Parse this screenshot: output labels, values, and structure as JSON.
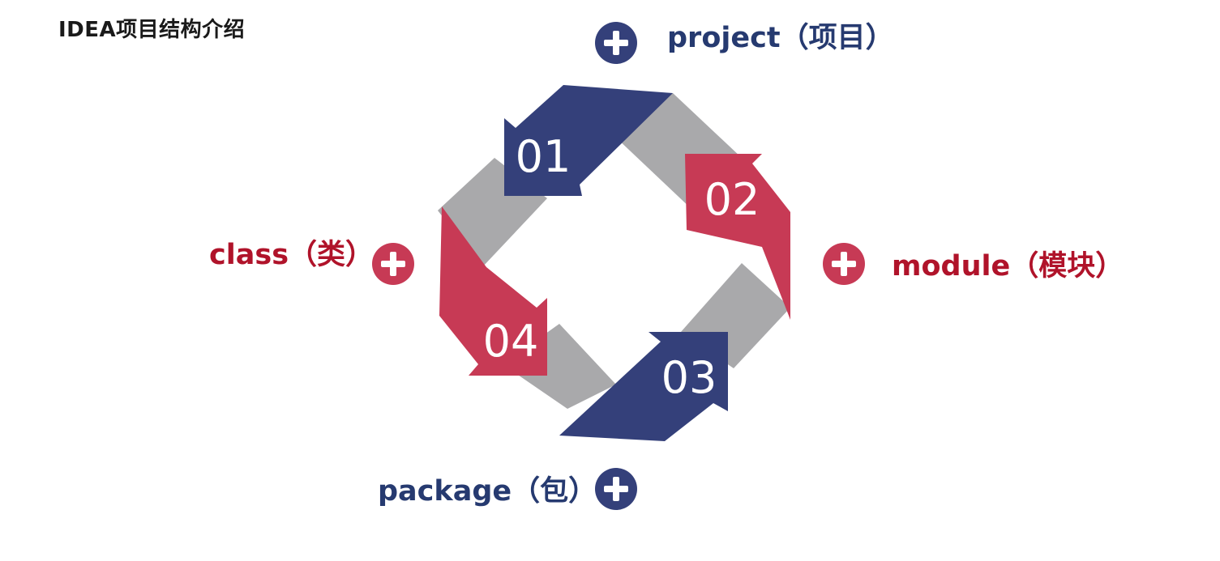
{
  "slide": {
    "title": "IDEA项目结构介绍"
  },
  "steps": [
    {
      "number": "01",
      "label": "project（项目）",
      "color": "#34407a"
    },
    {
      "number": "02",
      "label": "module（模块）",
      "color": "#c73a55"
    },
    {
      "number": "03",
      "label": "package（包）",
      "color": "#34407a"
    },
    {
      "number": "04",
      "label": "class（类）",
      "color": "#c73a55"
    }
  ],
  "colors": {
    "navy": "#34407a",
    "red": "#c73a55",
    "gray": "#a9a9ab",
    "navy_text": "#263a70",
    "red_text": "#b0132a"
  },
  "icons": [
    "plus-circle-icon"
  ]
}
